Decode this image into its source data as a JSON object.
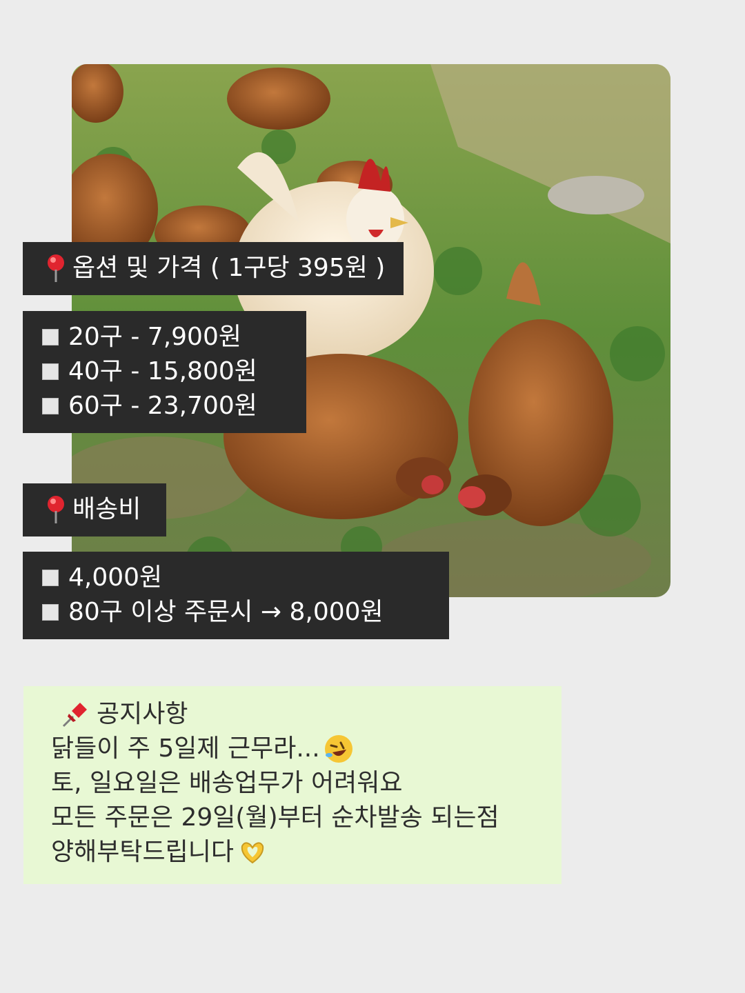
{
  "options": {
    "title": "옵션 및 가격 ( 1구당 395원 )",
    "prices": [
      "20구 - 7,900원",
      "40구 - 15,800원",
      "60구 - 23,700원"
    ]
  },
  "shipping": {
    "title": "배송비",
    "prices": [
      "4,000원",
      "80구 이상 주문시 → 8,000원"
    ]
  },
  "notice": {
    "title": "공지사항",
    "lines": [
      "닭들이 주 5일제 근무라...",
      "토, 일요일은 배송업무가 어려워요",
      "모든 주문은 29일(월)부터 순차발송 되는점",
      "양해부탁드립니다"
    ]
  },
  "colors": {
    "tag_bg": "#2a2a2a",
    "notice_bg": "#e8f8d4",
    "page_bg": "#ececec"
  },
  "icons": [
    "round-pushpin-icon",
    "pushpin-icon",
    "rofl-emoji-icon",
    "heart-hands-emoji-icon"
  ]
}
